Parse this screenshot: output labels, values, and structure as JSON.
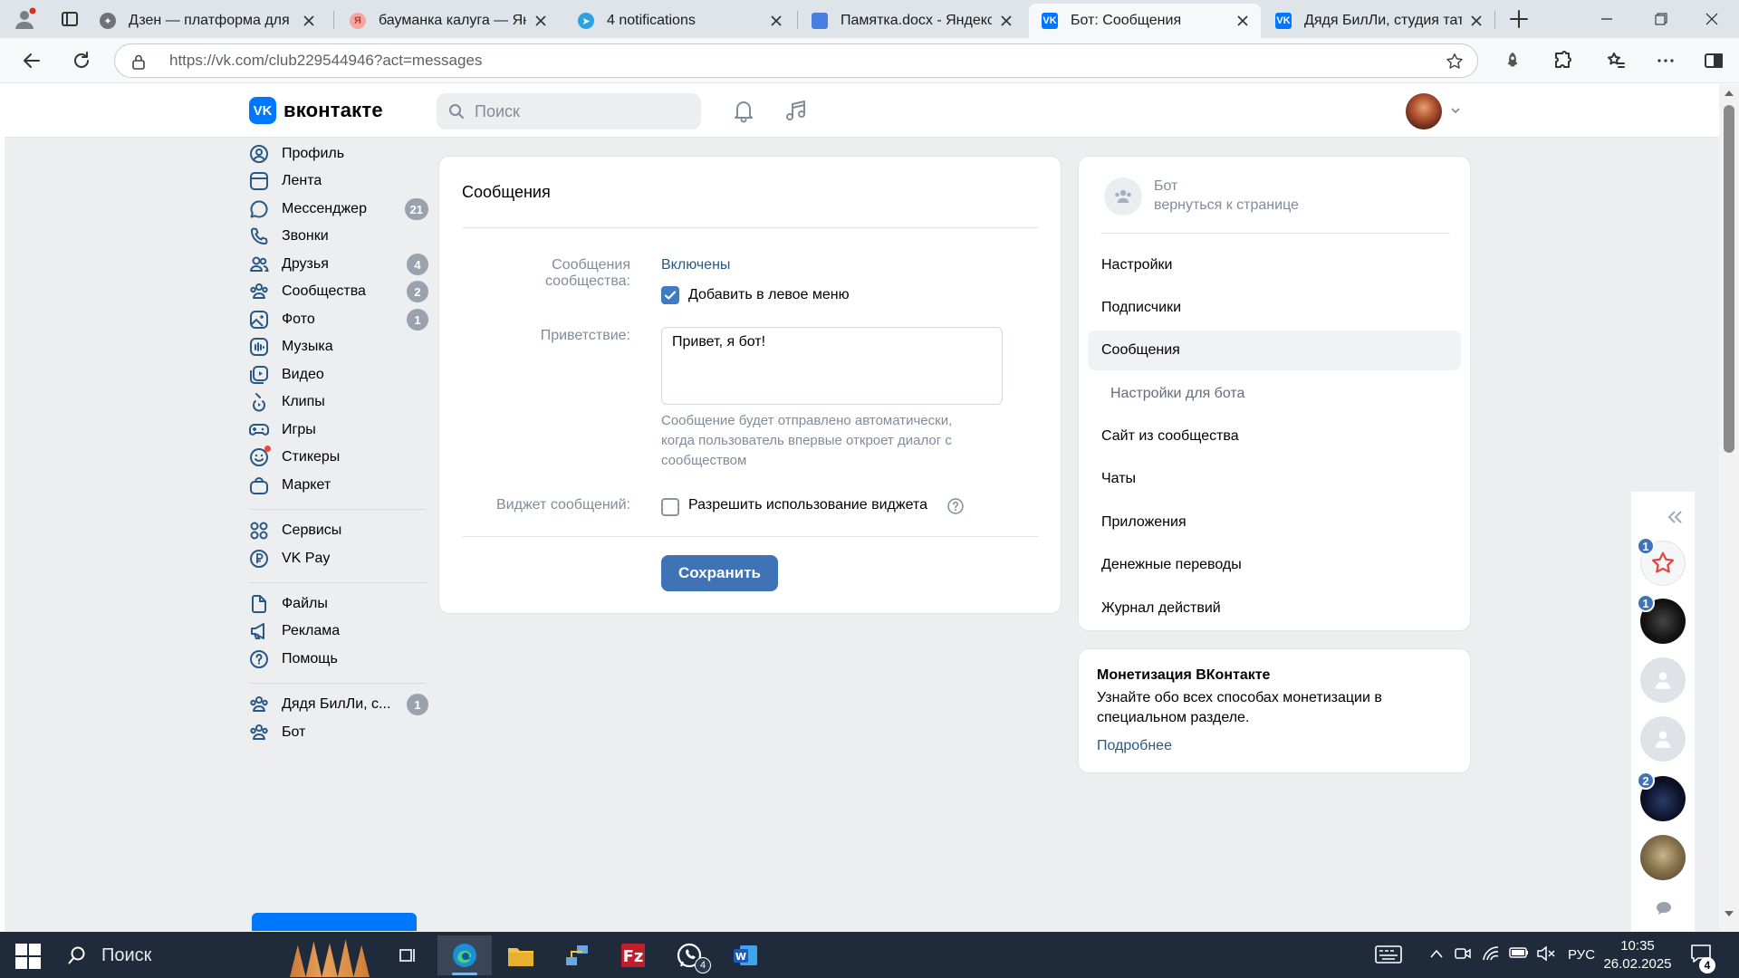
{
  "browser": {
    "tabs": [
      {
        "title": "Дзен — платформа для пр",
        "favicon": "dzen-icon",
        "active": false
      },
      {
        "title": "бауманка калуга — Яндекс",
        "favicon": "yandex-icon",
        "active": false
      },
      {
        "title": "4 notifications",
        "favicon": "telegram-icon",
        "active": false
      },
      {
        "title": "Памятка.docx - Яндекс До",
        "favicon": "yandex-docs-icon",
        "active": false
      },
      {
        "title": "Бот: Сообщения",
        "favicon": "vk-icon",
        "active": true
      },
      {
        "title": "Дядя БилЛи, студия тату, п",
        "favicon": "vk-icon",
        "active": false
      }
    ],
    "url": "https://vk.com/club229544946?act=messages"
  },
  "vk": {
    "logo_text": "вконтакте",
    "logo_mark": "VK",
    "search_placeholder": "Поиск",
    "menu": [
      {
        "label": "Профиль",
        "icon": "user-icon",
        "badge": ""
      },
      {
        "label": "Лента",
        "icon": "feed-icon",
        "badge": ""
      },
      {
        "label": "Мессенджер",
        "icon": "message-icon",
        "badge": "21"
      },
      {
        "label": "Звонки",
        "icon": "phone-icon",
        "badge": ""
      },
      {
        "label": "Друзья",
        "icon": "friends-icon",
        "badge": "4"
      },
      {
        "label": "Сообщества",
        "icon": "communities-icon",
        "badge": "2"
      },
      {
        "label": "Фото",
        "icon": "photo-icon",
        "badge": "1"
      },
      {
        "label": "Музыка",
        "icon": "music-icon",
        "badge": ""
      },
      {
        "label": "Видео",
        "icon": "video-icon",
        "badge": ""
      },
      {
        "label": "Клипы",
        "icon": "clips-icon",
        "badge": ""
      },
      {
        "label": "Игры",
        "icon": "games-icon",
        "badge": ""
      },
      {
        "label": "Стикеры",
        "icon": "stickers-icon",
        "badge": ""
      },
      {
        "label": "Маркет",
        "icon": "market-icon",
        "badge": ""
      },
      {
        "label": "Сервисы",
        "icon": "services-icon",
        "badge": ""
      },
      {
        "label": "VK Pay",
        "icon": "vkpay-icon",
        "badge": ""
      },
      {
        "label": "Файлы",
        "icon": "files-icon",
        "badge": ""
      },
      {
        "label": "Реклама",
        "icon": "ads-icon",
        "badge": ""
      },
      {
        "label": "Помощь",
        "icon": "help-icon",
        "badge": ""
      },
      {
        "label": "Дядя БилЛи, с...",
        "icon": "communities-icon",
        "badge": "1"
      },
      {
        "label": "Бот",
        "icon": "communities-icon",
        "badge": ""
      }
    ],
    "main": {
      "title": "Сообщения",
      "community_messages_label": "Сообщения сообщества:",
      "community_messages_value": "Включены",
      "add_left_menu_label": "Добавить в левое меню",
      "add_left_menu_checked": true,
      "greeting_label": "Приветствие:",
      "greeting_value": "Привет, я бот!",
      "greeting_hint": "Сообщение будет отправлено автоматически, когда пользователь впервые откроет диалог с сообществом",
      "widget_label": "Виджет сообщений:",
      "widget_checkbox_label": "Разрешить использование виджета",
      "widget_checked": false,
      "save_button": "Сохранить"
    },
    "right_nav": {
      "group_name": "Бот",
      "back_link": "вернуться к странице",
      "items": [
        {
          "label": "Настройки",
          "active": false,
          "sub": false
        },
        {
          "label": "Подписчики",
          "active": false,
          "sub": false
        },
        {
          "label": "Сообщения",
          "active": true,
          "sub": false
        },
        {
          "label": "Настройки для бота",
          "active": false,
          "sub": true
        },
        {
          "label": "Сайт из сообщества",
          "active": false,
          "sub": false
        },
        {
          "label": "Чаты",
          "active": false,
          "sub": false
        },
        {
          "label": "Приложения",
          "active": false,
          "sub": false
        },
        {
          "label": "Денежные переводы",
          "active": false,
          "sub": false
        },
        {
          "label": "Журнал действий",
          "active": false,
          "sub": false
        }
      ]
    },
    "monetization": {
      "title": "Монетизация ВКонтакте",
      "description": "Узнайте обо всех способах монетизации в специальном разделе.",
      "link": "Подробнее"
    },
    "chat_badges": [
      "1",
      "1",
      "2"
    ]
  },
  "taskbar": {
    "search_placeholder": "Поиск",
    "whatsapp_badge": "4",
    "language": "РУС",
    "time": "10:35",
    "date": "26.02.2025",
    "notification_count": "4"
  },
  "colors": {
    "vk_blue": "#0077ff",
    "link_blue": "#2a5885",
    "button_blue": "#3f73b5",
    "page_bg": "#edeef0",
    "badge_gray": "#99a2ad"
  }
}
